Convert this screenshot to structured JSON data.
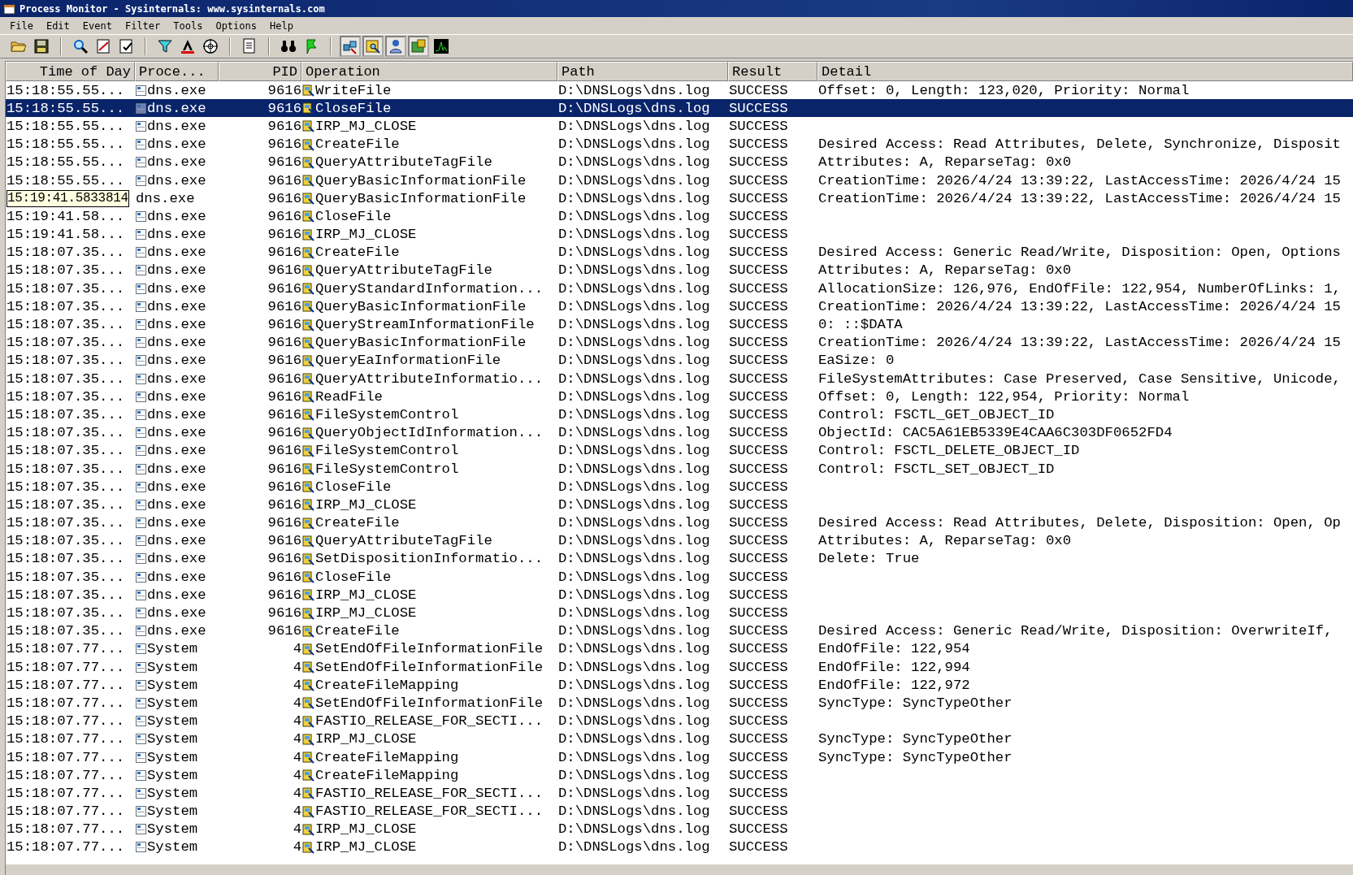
{
  "window": {
    "title": "Process Monitor - Sysinternals: www.sysinternals.com"
  },
  "menu": [
    "File",
    "Edit",
    "Event",
    "Filter",
    "Tools",
    "Options",
    "Help"
  ],
  "toolbar": {
    "event_class_buttons": [
      {
        "selected": true
      },
      {
        "selected": true
      },
      {
        "selected": true
      },
      {
        "selected": true
      },
      {
        "selected": false
      }
    ]
  },
  "table": {
    "columns": [
      "Time of Day",
      "Proce...",
      "PID",
      "Operation",
      "Path",
      "Result",
      "Detail"
    ],
    "rows": [
      {
        "time": "15:18:55.55...",
        "process": "dns.exe",
        "pid": "9616",
        "operation": "WriteFile",
        "path": "D:\\DNSLogs\\dns.log",
        "result": "SUCCESS",
        "detail": "Offset: 0, Length: 123,020, Priority: Normal",
        "selected": false
      },
      {
        "time": "15:18:55.55...",
        "process": "dns.exe",
        "pid": "9616",
        "operation": "CloseFile",
        "path": "D:\\DNSLogs\\dns.log",
        "result": "SUCCESS",
        "selected": true
      },
      {
        "time": "15:18:55.55...",
        "process": "dns.exe",
        "pid": "9616",
        "operation": "IRP_MJ_CLOSE",
        "path": "D:\\DNSLogs\\dns.log",
        "result": "SUCCESS",
        "selected": false
      },
      {
        "time": "15:18:55.55...",
        "process": "dns.exe",
        "pid": "9616",
        "operation": "CreateFile",
        "path": "D:\\DNSLogs\\dns.log",
        "result": "SUCCESS",
        "detail": "Desired Access: Read Attributes, Delete, Synchronize, Disposit",
        "selected": false
      },
      {
        "time": "15:18:55.55...",
        "process": "dns.exe",
        "pid": "9616",
        "operation": "QueryAttributeTagFile",
        "path": "D:\\DNSLogs\\dns.log",
        "result": "SUCCESS",
        "detail": "Attributes: A, ReparseTag: 0x0",
        "selected": false
      },
      {
        "time": "15:18:55.55...",
        "process": "dns.exe",
        "pid": "9616",
        "operation": "QueryBasicInformationFile",
        "path": "D:\\DNSLogs\\dns.log",
        "result": "SUCCESS",
        "detail": "CreationTime: 2026/4/24 13:39:22, LastAccessTime: 2026/4/24 15",
        "selected": false
      },
      {
        "time": "15:19:41.5833814",
        "time_tooltip": true,
        "process": "dns.exe",
        "pid": "9616",
        "operation": "QueryBasicInformationFile",
        "path": "D:\\DNSLogs\\dns.log",
        "result": "SUCCESS",
        "detail": "CreationTime: 2026/4/24 13:39:22, LastAccessTime: 2026/4/24 15",
        "selected": false
      },
      {
        "time": "15:19:41.58...",
        "process": "dns.exe",
        "pid": "9616",
        "operation": "CloseFile",
        "path": "D:\\DNSLogs\\dns.log",
        "result": "SUCCESS",
        "selected": false
      },
      {
        "time": "15:19:41.58...",
        "process": "dns.exe",
        "pid": "9616",
        "operation": "IRP_MJ_CLOSE",
        "path": "D:\\DNSLogs\\dns.log",
        "result": "SUCCESS",
        "selected": false
      },
      {
        "time": "15:18:07.35...",
        "process": "dns.exe",
        "pid": "9616",
        "operation": "CreateFile",
        "path": "D:\\DNSLogs\\dns.log",
        "result": "SUCCESS",
        "detail": "Desired Access: Generic Read/Write, Disposition: Open, Options",
        "selected": false
      },
      {
        "time": "15:18:07.35...",
        "process": "dns.exe",
        "pid": "9616",
        "operation": "QueryAttributeTagFile",
        "path": "D:\\DNSLogs\\dns.log",
        "result": "SUCCESS",
        "detail": "Attributes: A, ReparseTag: 0x0",
        "selected": false
      },
      {
        "time": "15:18:07.35...",
        "process": "dns.exe",
        "pid": "9616",
        "operation": "QueryStandardInformation...",
        "path": "D:\\DNSLogs\\dns.log",
        "result": "SUCCESS",
        "detail": "AllocationSize: 126,976, EndOfFile: 122,954, NumberOfLinks: 1,",
        "selected": false
      },
      {
        "time": "15:18:07.35...",
        "process": "dns.exe",
        "pid": "9616",
        "operation": "QueryBasicInformationFile",
        "path": "D:\\DNSLogs\\dns.log",
        "result": "SUCCESS",
        "detail": "CreationTime: 2026/4/24 13:39:22, LastAccessTime: 2026/4/24 15",
        "selected": false
      },
      {
        "time": "15:18:07.35...",
        "process": "dns.exe",
        "pid": "9616",
        "operation": "QueryStreamInformationFile",
        "path": "D:\\DNSLogs\\dns.log",
        "result": "SUCCESS",
        "detail": "0: ::$DATA",
        "selected": false
      },
      {
        "time": "15:18:07.35...",
        "process": "dns.exe",
        "pid": "9616",
        "operation": "QueryBasicInformationFile",
        "path": "D:\\DNSLogs\\dns.log",
        "result": "SUCCESS",
        "detail": "CreationTime: 2026/4/24 13:39:22, LastAccessTime: 2026/4/24 15",
        "selected": false
      },
      {
        "time": "15:18:07.35...",
        "process": "dns.exe",
        "pid": "9616",
        "operation": "QueryEaInformationFile",
        "path": "D:\\DNSLogs\\dns.log",
        "result": "SUCCESS",
        "detail": "EaSize: 0",
        "selected": false
      },
      {
        "time": "15:18:07.35...",
        "process": "dns.exe",
        "pid": "9616",
        "operation": "QueryAttributeInformatio...",
        "path": "D:\\DNSLogs\\dns.log",
        "result": "SUCCESS",
        "detail": "FileSystemAttributes: Case Preserved, Case Sensitive, Unicode,",
        "selected": false
      },
      {
        "time": "15:18:07.35...",
        "process": "dns.exe",
        "pid": "9616",
        "operation": "ReadFile",
        "path": "D:\\DNSLogs\\dns.log",
        "result": "SUCCESS",
        "detail": "Offset: 0, Length: 122,954, Priority: Normal",
        "selected": false
      },
      {
        "time": "15:18:07.35...",
        "process": "dns.exe",
        "pid": "9616",
        "operation": "FileSystemControl",
        "path": "D:\\DNSLogs\\dns.log",
        "result": "SUCCESS",
        "detail": "Control: FSCTL_GET_OBJECT_ID",
        "selected": false
      },
      {
        "time": "15:18:07.35...",
        "process": "dns.exe",
        "pid": "9616",
        "operation": "QueryObjectIdInformation...",
        "path": "D:\\DNSLogs\\dns.log",
        "result": "SUCCESS",
        "detail": "ObjectId: CAC5A61EB5339E4CAA6C303DF0652FD4",
        "selected": false
      },
      {
        "time": "15:18:07.35...",
        "process": "dns.exe",
        "pid": "9616",
        "operation": "FileSystemControl",
        "path": "D:\\DNSLogs\\dns.log",
        "result": "SUCCESS",
        "detail": "Control: FSCTL_DELETE_OBJECT_ID",
        "selected": false
      },
      {
        "time": "15:18:07.35...",
        "process": "dns.exe",
        "pid": "9616",
        "operation": "FileSystemControl",
        "path": "D:\\DNSLogs\\dns.log",
        "result": "SUCCESS",
        "detail": "Control: FSCTL_SET_OBJECT_ID",
        "selected": false
      },
      {
        "time": "15:18:07.35...",
        "process": "dns.exe",
        "pid": "9616",
        "operation": "CloseFile",
        "path": "D:\\DNSLogs\\dns.log",
        "result": "SUCCESS",
        "selected": false
      },
      {
        "time": "15:18:07.35...",
        "process": "dns.exe",
        "pid": "9616",
        "operation": "IRP_MJ_CLOSE",
        "path": "D:\\DNSLogs\\dns.log",
        "result": "SUCCESS",
        "selected": false
      },
      {
        "time": "15:18:07.35...",
        "process": "dns.exe",
        "pid": "9616",
        "operation": "CreateFile",
        "path": "D:\\DNSLogs\\dns.log",
        "result": "SUCCESS",
        "detail": "Desired Access: Read Attributes, Delete, Disposition: Open, Op",
        "selected": false
      },
      {
        "time": "15:18:07.35...",
        "process": "dns.exe",
        "pid": "9616",
        "operation": "QueryAttributeTagFile",
        "path": "D:\\DNSLogs\\dns.log",
        "result": "SUCCESS",
        "detail": "Attributes: A, ReparseTag: 0x0",
        "selected": false
      },
      {
        "time": "15:18:07.35...",
        "process": "dns.exe",
        "pid": "9616",
        "operation": "SetDispositionInformatio...",
        "path": "D:\\DNSLogs\\dns.log",
        "result": "SUCCESS",
        "detail": "Delete: True",
        "selected": false
      },
      {
        "time": "15:18:07.35...",
        "process": "dns.exe",
        "pid": "9616",
        "operation": "CloseFile",
        "path": "D:\\DNSLogs\\dns.log",
        "result": "SUCCESS",
        "selected": false
      },
      {
        "time": "15:18:07.35...",
        "process": "dns.exe",
        "pid": "9616",
        "operation": "IRP_MJ_CLOSE",
        "path": "D:\\DNSLogs\\dns.log",
        "result": "SUCCESS",
        "selected": false
      },
      {
        "time": "15:18:07.35...",
        "process": "dns.exe",
        "pid": "9616",
        "operation": "IRP_MJ_CLOSE",
        "path": "D:\\DNSLogs\\dns.log",
        "result": "SUCCESS",
        "selected": false
      },
      {
        "time": "15:18:07.35...",
        "process": "dns.exe",
        "pid": "9616",
        "operation": "CreateFile",
        "path": "D:\\DNSLogs\\dns.log",
        "result": "SUCCESS",
        "detail": "Desired Access: Generic Read/Write, Disposition: OverwriteIf,",
        "selected": false
      },
      {
        "time": "15:18:07.77...",
        "process": "System",
        "pid": "4",
        "operation": "SetEndOfFileInformationFile",
        "path": "D:\\DNSLogs\\dns.log",
        "result": "SUCCESS",
        "detail": "EndOfFile: 122,954",
        "selected": false
      },
      {
        "time": "15:18:07.77...",
        "process": "System",
        "pid": "4",
        "operation": "SetEndOfFileInformationFile",
        "path": "D:\\DNSLogs\\dns.log",
        "result": "SUCCESS",
        "detail": "EndOfFile: 122,994",
        "selected": false
      },
      {
        "time": "15:18:07.77...",
        "process": "System",
        "pid": "4",
        "operation": "CreateFileMapping",
        "path": "D:\\DNSLogs\\dns.log",
        "result": "SUCCESS",
        "detail": "EndOfFile: 122,972",
        "selected": false
      },
      {
        "time": "15:18:07.77...",
        "process": "System",
        "pid": "4",
        "operation": "SetEndOfFileInformationFile",
        "path": "D:\\DNSLogs\\dns.log",
        "result": "SUCCESS",
        "detail": "SyncType: SyncTypeOther",
        "selected": false
      },
      {
        "time": "15:18:07.77...",
        "process": "System",
        "pid": "4",
        "operation": "FASTIO_RELEASE_FOR_SECTI...",
        "path": "D:\\DNSLogs\\dns.log",
        "result": "SUCCESS",
        "selected": false
      },
      {
        "time": "15:18:07.77...",
        "process": "System",
        "pid": "4",
        "operation": "IRP_MJ_CLOSE",
        "path": "D:\\DNSLogs\\dns.log",
        "result": "SUCCESS",
        "detail": "SyncType: SyncTypeOther",
        "selected": false
      },
      {
        "time": "15:18:07.77...",
        "process": "System",
        "pid": "4",
        "operation": "CreateFileMapping",
        "path": "D:\\DNSLogs\\dns.log",
        "result": "SUCCESS",
        "detail": "SyncType: SyncTypeOther",
        "selected": false
      },
      {
        "time": "15:18:07.77...",
        "process": "System",
        "pid": "4",
        "operation": "CreateFileMapping",
        "path": "D:\\DNSLogs\\dns.log",
        "result": "SUCCESS",
        "selected": false
      },
      {
        "time": "15:18:07.77...",
        "process": "System",
        "pid": "4",
        "operation": "FASTIO_RELEASE_FOR_SECTI...",
        "path": "D:\\DNSLogs\\dns.log",
        "result": "SUCCESS",
        "selected": false
      },
      {
        "time": "15:18:07.77...",
        "process": "System",
        "pid": "4",
        "operation": "FASTIO_RELEASE_FOR_SECTI...",
        "path": "D:\\DNSLogs\\dns.log",
        "result": "SUCCESS",
        "selected": false
      },
      {
        "time": "15:18:07.77...",
        "process": "System",
        "pid": "4",
        "operation": "IRP_MJ_CLOSE",
        "path": "D:\\DNSLogs\\dns.log",
        "result": "SUCCESS",
        "selected": false
      },
      {
        "time": "15:18:07.77...",
        "process": "System",
        "pid": "4",
        "operation": "IRP_MJ_CLOSE",
        "path": "D:\\DNSLogs\\dns.log",
        "result": "SUCCESS",
        "selected": false
      }
    ]
  }
}
